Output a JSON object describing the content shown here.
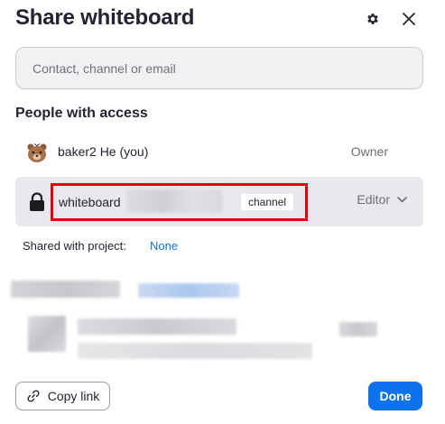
{
  "dialog": {
    "title": "Share whiteboard",
    "header_icons": [
      "gear-icon",
      "close-icon"
    ]
  },
  "search": {
    "placeholder": "Contact, channel or email"
  },
  "access": {
    "heading": "People with access",
    "owner": {
      "avatar_icon": "bear-avatar",
      "name": "baker2 He (you)",
      "role": "Owner"
    },
    "channel": {
      "icon": "lock-icon",
      "name": "whiteboard",
      "badge": "channel",
      "role": "Editor",
      "highlight_color": "#e0000f"
    }
  },
  "shared_with_project": {
    "label": "Shared with project:",
    "value": "None"
  },
  "footer": {
    "copy_link_label": "Copy link",
    "done_label": "Done"
  },
  "colors": {
    "accent": "#0e72ed",
    "row_bg": "#e8e8ed"
  }
}
